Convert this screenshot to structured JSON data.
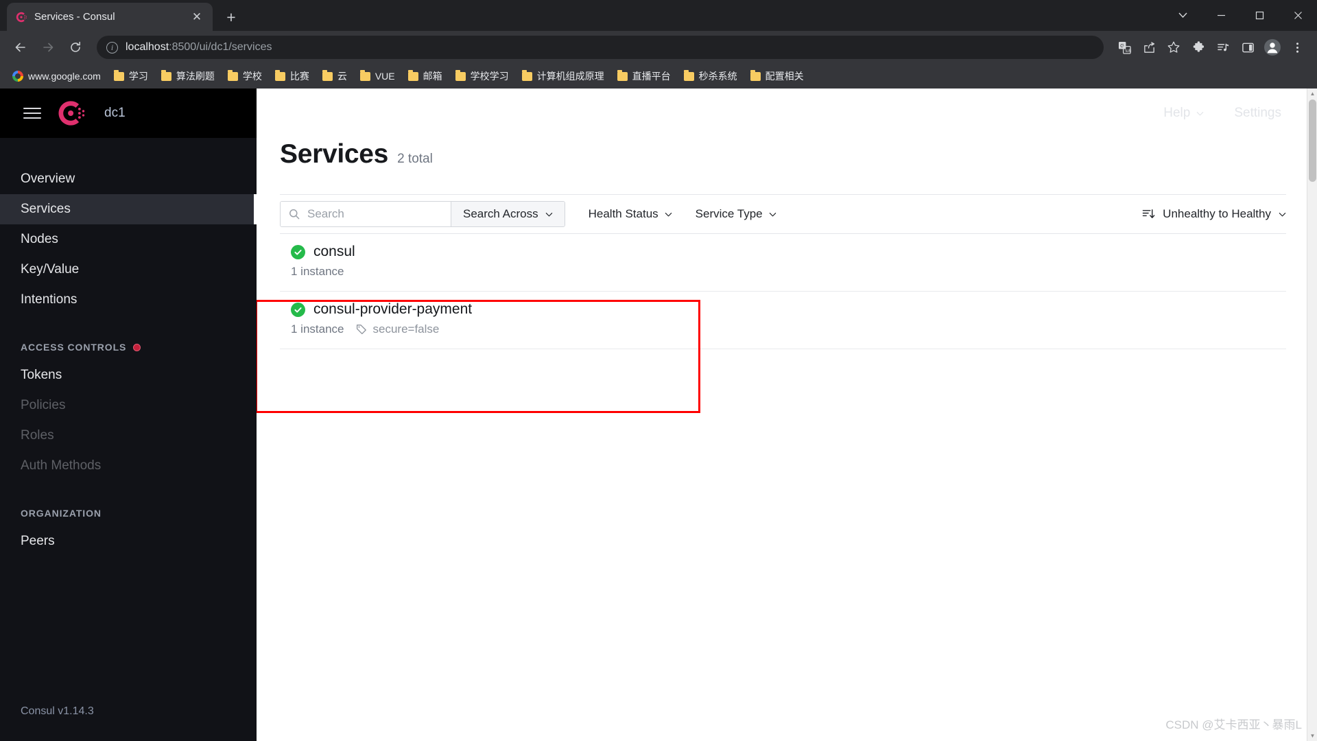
{
  "browser": {
    "tab": {
      "title": "Services - Consul",
      "favicon": "consul-logo-icon",
      "close": "✕"
    },
    "new_tab": "+",
    "window_controls": {
      "more": "⌄",
      "minimize": "─",
      "maximize": "☐",
      "close": "✕"
    },
    "nav": {
      "back": "←",
      "forward": "→",
      "reload": "⟳"
    },
    "omnibox": {
      "info_icon": "i",
      "url_host": "localhost",
      "url_rest": ":8500/ui/dc1/services"
    },
    "toolbar_icons": [
      {
        "name": "translate-icon",
        "glyph": "G"
      },
      {
        "name": "share-icon",
        "glyph": "⤴"
      },
      {
        "name": "bookmark-star-icon",
        "glyph": "☆"
      },
      {
        "name": "extensions-puzzle-icon",
        "glyph": "⧉"
      },
      {
        "name": "media-control-icon",
        "glyph": "♫"
      },
      {
        "name": "side-panel-icon",
        "glyph": "▢"
      },
      {
        "name": "profile-avatar-icon",
        "glyph": "●"
      },
      {
        "name": "chrome-menu-icon",
        "glyph": "⋮"
      }
    ],
    "bookmarks": [
      {
        "label": "www.google.com",
        "icon": "google-icon"
      },
      {
        "label": "学习",
        "icon": "folder-icon"
      },
      {
        "label": "算法刷题",
        "icon": "folder-icon"
      },
      {
        "label": "学校",
        "icon": "folder-icon"
      },
      {
        "label": "比赛",
        "icon": "folder-icon"
      },
      {
        "label": "云",
        "icon": "folder-icon"
      },
      {
        "label": "VUE",
        "icon": "folder-icon"
      },
      {
        "label": "邮箱",
        "icon": "folder-icon"
      },
      {
        "label": "学校学习",
        "icon": "folder-icon"
      },
      {
        "label": "计算机组成原理",
        "icon": "folder-icon"
      },
      {
        "label": "直播平台",
        "icon": "folder-icon"
      },
      {
        "label": "秒杀系统",
        "icon": "folder-icon"
      },
      {
        "label": "配置相关",
        "icon": "folder-icon"
      }
    ]
  },
  "consul": {
    "datacenter": "dc1",
    "header": {
      "help": "Help",
      "settings": "Settings"
    },
    "nav_primary": [
      {
        "label": "Overview",
        "active": false,
        "muted": false
      },
      {
        "label": "Services",
        "active": true,
        "muted": false
      },
      {
        "label": "Nodes",
        "active": false,
        "muted": false
      },
      {
        "label": "Key/Value",
        "active": false,
        "muted": false
      },
      {
        "label": "Intentions",
        "active": false,
        "muted": false
      }
    ],
    "section_access_controls": "ACCESS CONTROLS",
    "nav_access": [
      {
        "label": "Tokens",
        "muted": false
      },
      {
        "label": "Policies",
        "muted": true
      },
      {
        "label": "Roles",
        "muted": true
      },
      {
        "label": "Auth Methods",
        "muted": true
      }
    ],
    "section_organization": "ORGANIZATION",
    "nav_org": [
      {
        "label": "Peers",
        "muted": false
      }
    ],
    "version": "Consul v1.14.3",
    "main": {
      "title": "Services",
      "count": "2 total",
      "search_placeholder": "Search",
      "search_value": "",
      "search_across": "Search Across",
      "filters": [
        {
          "label": "Health Status"
        },
        {
          "label": "Service Type"
        }
      ],
      "sort": {
        "label": "Unhealthy to Healthy",
        "icon": "sort-descending-icon"
      },
      "services": [
        {
          "name": "consul",
          "health": "passing",
          "instances": "1 instance",
          "tags": [],
          "highlighted": false
        },
        {
          "name": "consul-provider-payment",
          "health": "passing",
          "instances": "1 instance",
          "tags": [
            "secure=false"
          ],
          "highlighted": true
        }
      ]
    }
  },
  "watermark": "CSDN @艾卡西亚丶暴雨L",
  "colors": {
    "brand_pink": "#e0306e",
    "health_green": "#25ba4a",
    "highlight_red": "#ff0000",
    "sidebar_bg": "#111217",
    "acl_badge": "#c4203b"
  }
}
